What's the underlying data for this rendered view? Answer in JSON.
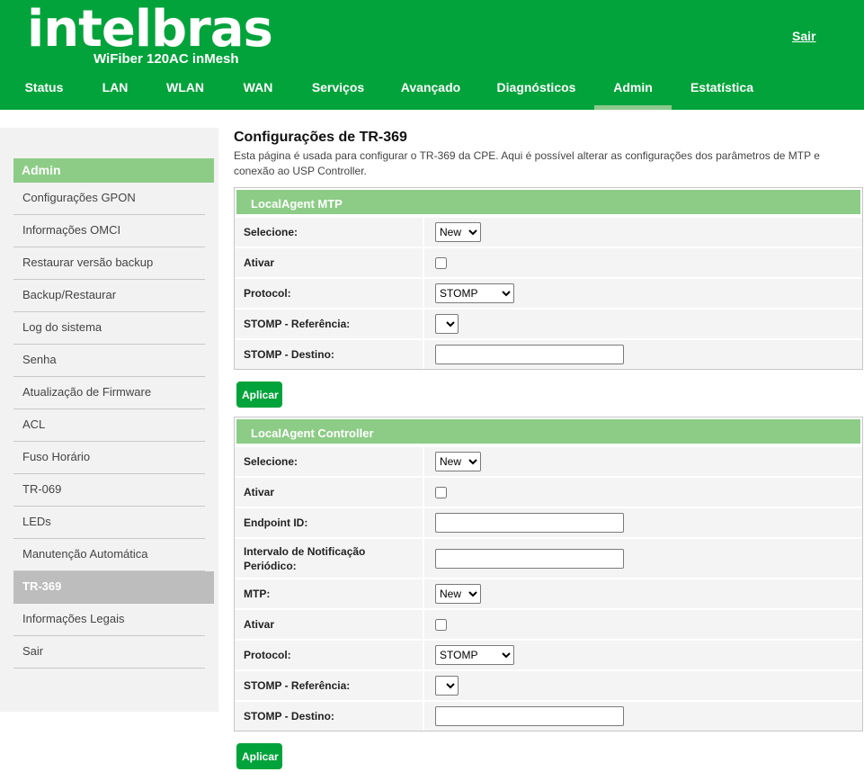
{
  "header": {
    "logo": "intelbras",
    "model": "WiFiber 120AC inMesh",
    "logout": "Sair"
  },
  "nav": [
    {
      "label": "Status"
    },
    {
      "label": "LAN"
    },
    {
      "label": "WLAN"
    },
    {
      "label": "WAN"
    },
    {
      "label": "Serviços"
    },
    {
      "label": "Avançado"
    },
    {
      "label": "Diagnósticos"
    },
    {
      "label": "Admin",
      "active": true
    },
    {
      "label": "Estatística"
    }
  ],
  "sidebar": {
    "title": "Admin",
    "items": [
      {
        "label": "Configurações GPON"
      },
      {
        "label": "Informações OMCI"
      },
      {
        "label": "Restaurar versão backup"
      },
      {
        "label": "Backup/Restaurar"
      },
      {
        "label": "Log do sistema"
      },
      {
        "label": "Senha"
      },
      {
        "label": "Atualização de Firmware"
      },
      {
        "label": "ACL"
      },
      {
        "label": "Fuso Horário"
      },
      {
        "label": "TR-069"
      },
      {
        "label": "LEDs"
      },
      {
        "label": "Manutenção Automática"
      },
      {
        "label": "TR-369",
        "active": true
      },
      {
        "label": "Informações Legais"
      },
      {
        "label": "Sair"
      }
    ]
  },
  "main": {
    "title": "Configurações de TR-369",
    "description": "Esta página é usada para configurar o TR-369 da CPE. Aqui é possível alterar as configurações dos parâmetros de MTP e conexão ao USP Controller.",
    "mtp_section": {
      "title": "LocalAgent MTP",
      "select_label": "Selecione:",
      "select_value": "New",
      "enable_label": "Ativar",
      "protocol_label": "Protocol:",
      "protocol_value": "STOMP",
      "stomp_ref_label": "STOMP - Referência:",
      "stomp_ref_value": "",
      "stomp_dest_label": "STOMP - Destino:",
      "stomp_dest_value": "",
      "apply": "Aplicar"
    },
    "controller_section": {
      "title": "LocalAgent Controller",
      "select_label": "Selecione:",
      "select_value": "New",
      "enable_label": "Ativar",
      "endpoint_label": "Endpoint ID:",
      "endpoint_value": "",
      "interval_label": "Intervalo de Notificação Periódico:",
      "interval_value": "",
      "mtp_label": "MTP:",
      "mtp_value": "New",
      "enable2_label": "Ativar",
      "protocol_label": "Protocol:",
      "protocol_value": "STOMP",
      "stomp_ref_label": "STOMP - Referência:",
      "stomp_ref_value": "",
      "stomp_dest_label": "STOMP - Destino:",
      "stomp_dest_value": "",
      "apply": "Aplicar"
    }
  },
  "colors": {
    "brand_green": "#03a33b",
    "section_green": "#8ccc86",
    "sidebar_bg": "#f2f2f2",
    "active_item": "#bdbdbd"
  }
}
